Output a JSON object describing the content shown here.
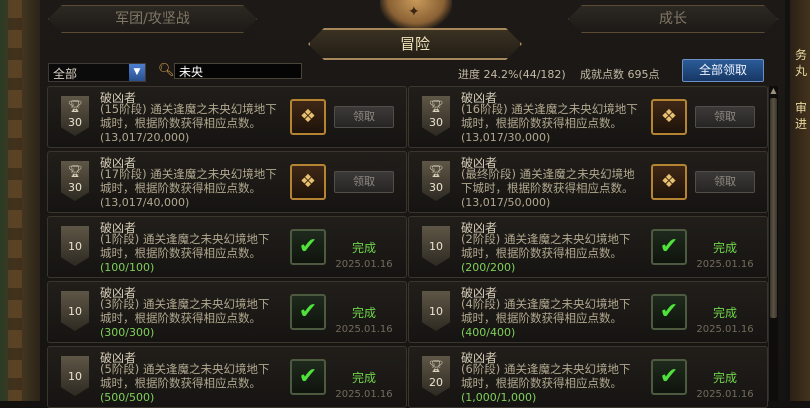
{
  "tabs": {
    "left": "军团/攻坚战",
    "right": "成长",
    "current": "冒险"
  },
  "ornament_icon": "compass-icon",
  "filter": {
    "selected": "全部",
    "search_value": "未央"
  },
  "stats": {
    "progress": "进度  24.2%(44/182)",
    "points": "成就点数 695点"
  },
  "claim_all_label": "全部领取",
  "side_text": [
    "务",
    "丸",
    "审",
    "进"
  ],
  "colors": {
    "accent_blue": "#2c5b98",
    "complete_green": "#6fd64a",
    "gold": "#b58433"
  },
  "cards": [
    {
      "title": "破凶者",
      "desc": "(15阶段) 通关逢魔之未央幻境地下城时，根据阶数获得相应点数。",
      "progress": "(13,017/20,000)",
      "points": "30",
      "completed": false,
      "button": "领取",
      "icon": "reward-box-icon"
    },
    {
      "title": "破凶者",
      "desc": "(16阶段) 通关逢魔之未央幻境地下城时，根据阶数获得相应点数。",
      "progress": "(13,017/30,000)",
      "points": "30",
      "completed": false,
      "button": "领取",
      "icon": "reward-box-icon"
    },
    {
      "title": "破凶者",
      "desc": "(17阶段) 通关逢魔之未央幻境地下城时，根据阶数获得相应点数。",
      "progress": "(13,017/40,000)",
      "points": "30",
      "completed": false,
      "button": "领取",
      "icon": "reward-box-icon"
    },
    {
      "title": "破凶者",
      "desc": "(最终阶段) 通关逢魔之未央幻境地下城时，根据阶数获得相应点数。",
      "progress": "(13,017/50,000)",
      "points": "30",
      "completed": false,
      "button": "领取",
      "icon": "reward-box-icon"
    },
    {
      "title": "破凶者",
      "desc": "(1阶段) 通关逢魔之未央幻境地下城时，根据阶数获得相应点数。",
      "progress": "(100/100)",
      "points": "10",
      "completed": true,
      "status": "完成",
      "date": "2025.01.16",
      "icon": "check-icon"
    },
    {
      "title": "破凶者",
      "desc": "(2阶段) 通关逢魔之未央幻境地下城时，根据阶数获得相应点数。",
      "progress": "(200/200)",
      "points": "10",
      "completed": true,
      "status": "完成",
      "date": "2025.01.16",
      "icon": "check-icon"
    },
    {
      "title": "破凶者",
      "desc": "(3阶段) 通关逢魔之未央幻境地下城时，根据阶数获得相应点数。",
      "progress": "(300/300)",
      "points": "10",
      "completed": true,
      "status": "完成",
      "date": "2025.01.16",
      "icon": "check-icon"
    },
    {
      "title": "破凶者",
      "desc": "(4阶段) 通关逢魔之未央幻境地下城时，根据阶数获得相应点数。",
      "progress": "(400/400)",
      "points": "10",
      "completed": true,
      "status": "完成",
      "date": "2025.01.16",
      "icon": "check-icon"
    },
    {
      "title": "破凶者",
      "desc": "(5阶段) 通关逢魔之未央幻境地下城时，根据阶数获得相应点数。",
      "progress": "(500/500)",
      "points": "10",
      "completed": true,
      "status": "完成",
      "date": "2025.01.16",
      "icon": "check-icon"
    },
    {
      "title": "破凶者",
      "desc": "(6阶段) 通关逢魔之未央幻境地下城时，根据阶数获得相应点数。",
      "progress": "(1,000/1,000)",
      "points": "20",
      "completed": true,
      "status": "完成",
      "date": "2025.01.16",
      "icon": "check-icon"
    }
  ]
}
